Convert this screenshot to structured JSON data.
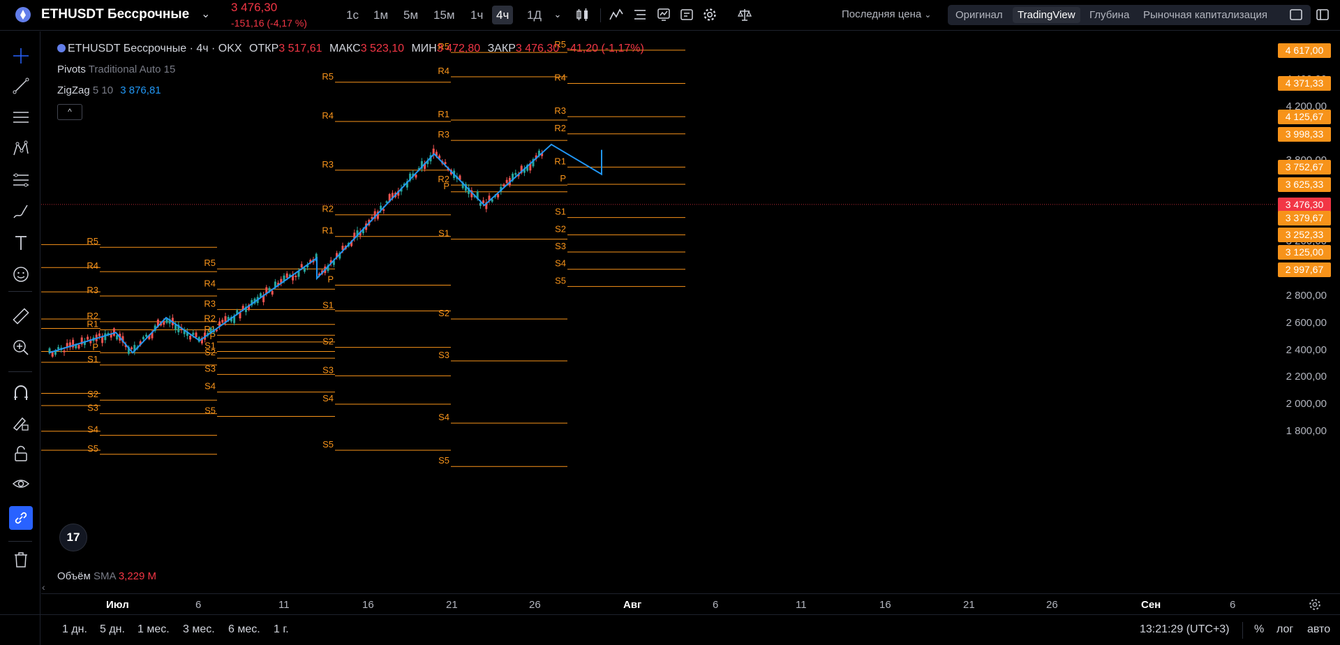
{
  "topbar": {
    "symbol": "ETHUSDT Бессрочные",
    "last_price": "3 476,30",
    "change": "-151,16 (-4,17 %)",
    "timeframes": [
      "1с",
      "1м",
      "5м",
      "15м",
      "1ч",
      "4ч",
      "1Д"
    ],
    "active_timeframe": "4ч",
    "price_type": "Последняя цена",
    "chart_types": [
      "Оригинал",
      "TradingView",
      "Глубина",
      "Рыночная капитализация"
    ],
    "active_chart_type": "TradingView"
  },
  "legend": {
    "title": "ETHUSDT Бессрочные · 4ч · OKX",
    "open_label": "ОТКР",
    "open": "3 517,61",
    "high_label": "МАКС",
    "high": "3 523,10",
    "low_label": "МИН",
    "low": "3 472,80",
    "close_label": "ЗАКР",
    "close": "3 476,30",
    "change": "-41,20 (-1,17%)",
    "pivots_name": "Pivots",
    "pivots_params": "Traditional Auto 15",
    "zigzag_name": "ZigZag",
    "zigzag_params": "5 10",
    "zigzag_value": "3 876,81",
    "collapse": "^",
    "volume_name": "Объём",
    "volume_params": "SMA",
    "volume_value": "3,229 M",
    "logo": "17"
  },
  "price_axis": {
    "labels": [
      "4 400,00",
      "4 200,00",
      "3 800,00",
      "3 200,00",
      "2 800,00",
      "2 600,00",
      "2 400,00",
      "2 200,00",
      "2 000,00",
      "1 800,00"
    ],
    "tags": [
      {
        "text": "4 617,00",
        "color": "#f7931a"
      },
      {
        "text": "4 371,33",
        "color": "#f7931a"
      },
      {
        "text": "4 125,67",
        "color": "#f7931a"
      },
      {
        "text": "3 998,33",
        "color": "#f7931a"
      },
      {
        "text": "3 752,67",
        "color": "#f7931a"
      },
      {
        "text": "3 625,33",
        "color": "#f7931a"
      },
      {
        "text": "3 476,30",
        "color": "#f23645"
      },
      {
        "text": "3 379,67",
        "color": "#f7931a"
      },
      {
        "text": "3 252,33",
        "color": "#f7931a"
      },
      {
        "text": "3 125,00",
        "color": "#f7931a"
      },
      {
        "text": "2 997,67",
        "color": "#f7931a"
      }
    ]
  },
  "time_axis": {
    "labels": [
      "Июл",
      "6",
      "11",
      "16",
      "21",
      "26",
      "Авг",
      "6",
      "11",
      "16",
      "21",
      "26",
      "Сен",
      "6"
    ]
  },
  "bottombar": {
    "ranges": [
      "1 дн.",
      "5 дн.",
      "1 мес.",
      "3 мес.",
      "6 мес.",
      "1 г."
    ],
    "clock": "13:21:29 (UTC+3)",
    "percent": "%",
    "log": "лог",
    "auto": "авто"
  },
  "chart_data": {
    "type": "candlestick",
    "symbol": "ETHUSDT",
    "timeframe": "4h",
    "last_price": 3476.3,
    "x_range": [
      "2024-06-29",
      "2024-09-10"
    ],
    "y_range": [
      1650,
      4700
    ],
    "price_ticks": [
      1800,
      2000,
      2200,
      2400,
      2600,
      2800,
      3200,
      3800,
      4200,
      4400
    ],
    "zigzag": [
      {
        "date": "2024-06-29",
        "price": 2380
      },
      {
        "date": "2024-07-03",
        "price": 2530
      },
      {
        "date": "2024-07-04",
        "price": 2380
      },
      {
        "date": "2024-07-06",
        "price": 2640
      },
      {
        "date": "2024-07-08",
        "price": 2470
      },
      {
        "date": "2024-07-15",
        "price": 3080
      },
      {
        "date": "2024-07-15",
        "price": 2930
      },
      {
        "date": "2024-07-22",
        "price": 3850
      },
      {
        "date": "2024-07-25",
        "price": 3470
      },
      {
        "date": "2024-07-29",
        "price": 3920
      },
      {
        "date": "2024-08-01",
        "price": 3700
      },
      {
        "date": "2024-08-01",
        "price": 3880
      }
    ],
    "pivot_labels": [
      "R5",
      "R4",
      "R3",
      "R2",
      "R1",
      "P",
      "S1",
      "S2",
      "S3",
      "S4",
      "S5"
    ],
    "pivot_periods": [
      {
        "levels": [
          3160,
          2980,
          2800,
          2610,
          2550,
          2380,
          2290,
          2030,
          1930,
          1770,
          1630
        ]
      },
      {
        "levels": [
          3000,
          2850,
          2700,
          2590,
          2510,
          2460,
          2390,
          2340,
          2220,
          2090,
          1910
        ]
      },
      {
        "levels": [
          4380,
          4090,
          3730,
          3400,
          3240,
          2880,
          2690,
          2420,
          2210,
          2000,
          1660
        ]
      },
      {
        "levels": [
          4600,
          4420,
          3950,
          3620,
          4100,
          3570,
          3220,
          2630,
          2320,
          1860,
          1540
        ]
      },
      {
        "levels": [
          4617,
          4371.33,
          4125.67,
          3998.33,
          3752.67,
          3625.33,
          3379.67,
          3252.33,
          3125,
          2997.67,
          2870
        ]
      }
    ]
  }
}
